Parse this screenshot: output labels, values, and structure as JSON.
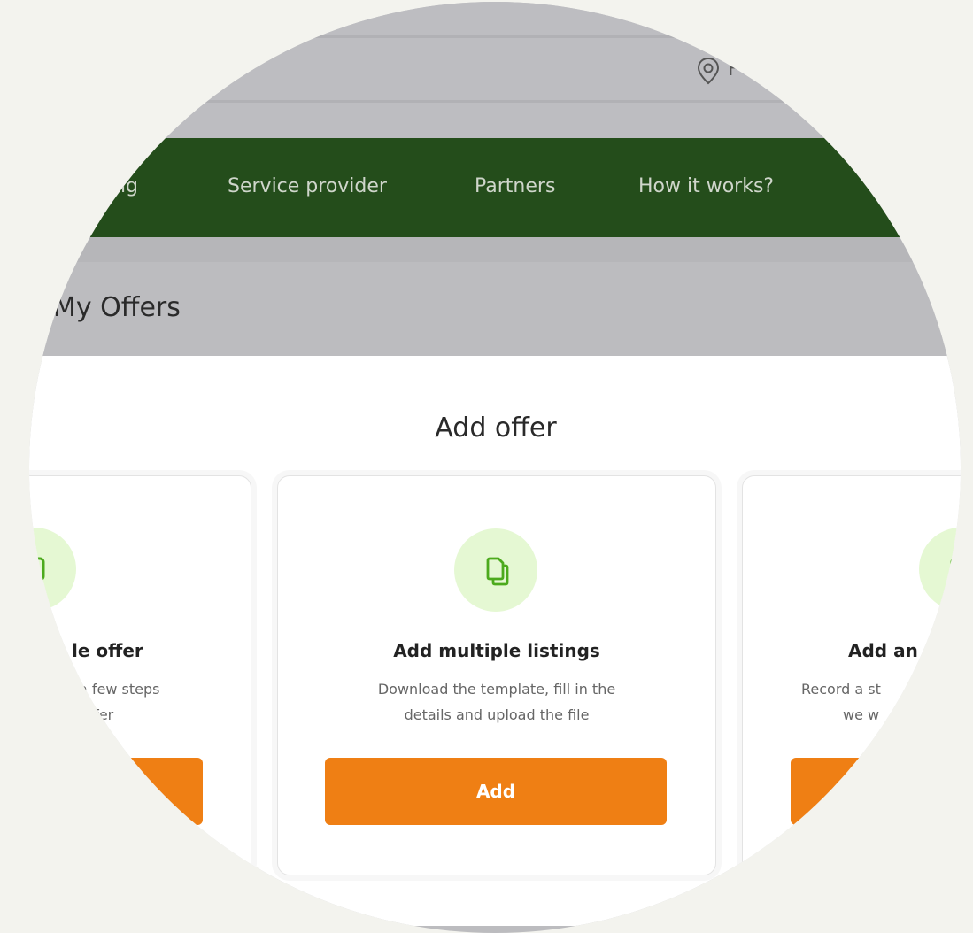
{
  "header": {
    "location_text": "F"
  },
  "nav": {
    "items": [
      "ng",
      "Service provider",
      "Partners",
      "How it works?"
    ]
  },
  "page": {
    "title": "My Offers"
  },
  "panel": {
    "title": "Add offer"
  },
  "cards": [
    {
      "title": "le offer",
      "desc_line1": "a few steps",
      "desc_line2": "offer",
      "button": ""
    },
    {
      "title": "Add multiple listings",
      "desc_line1": "Download the template, fill in the",
      "desc_line2": "details and upload the file",
      "button": "Add"
    },
    {
      "title": "Add an",
      "desc_line1": "Record a st",
      "desc_line2": "we w",
      "button": ""
    }
  ],
  "colors": {
    "accent": "#ef7f14",
    "nav_bg": "#244d1b",
    "icon_bg": "#e5f8d3",
    "icon_stroke": "#4caa1d"
  }
}
